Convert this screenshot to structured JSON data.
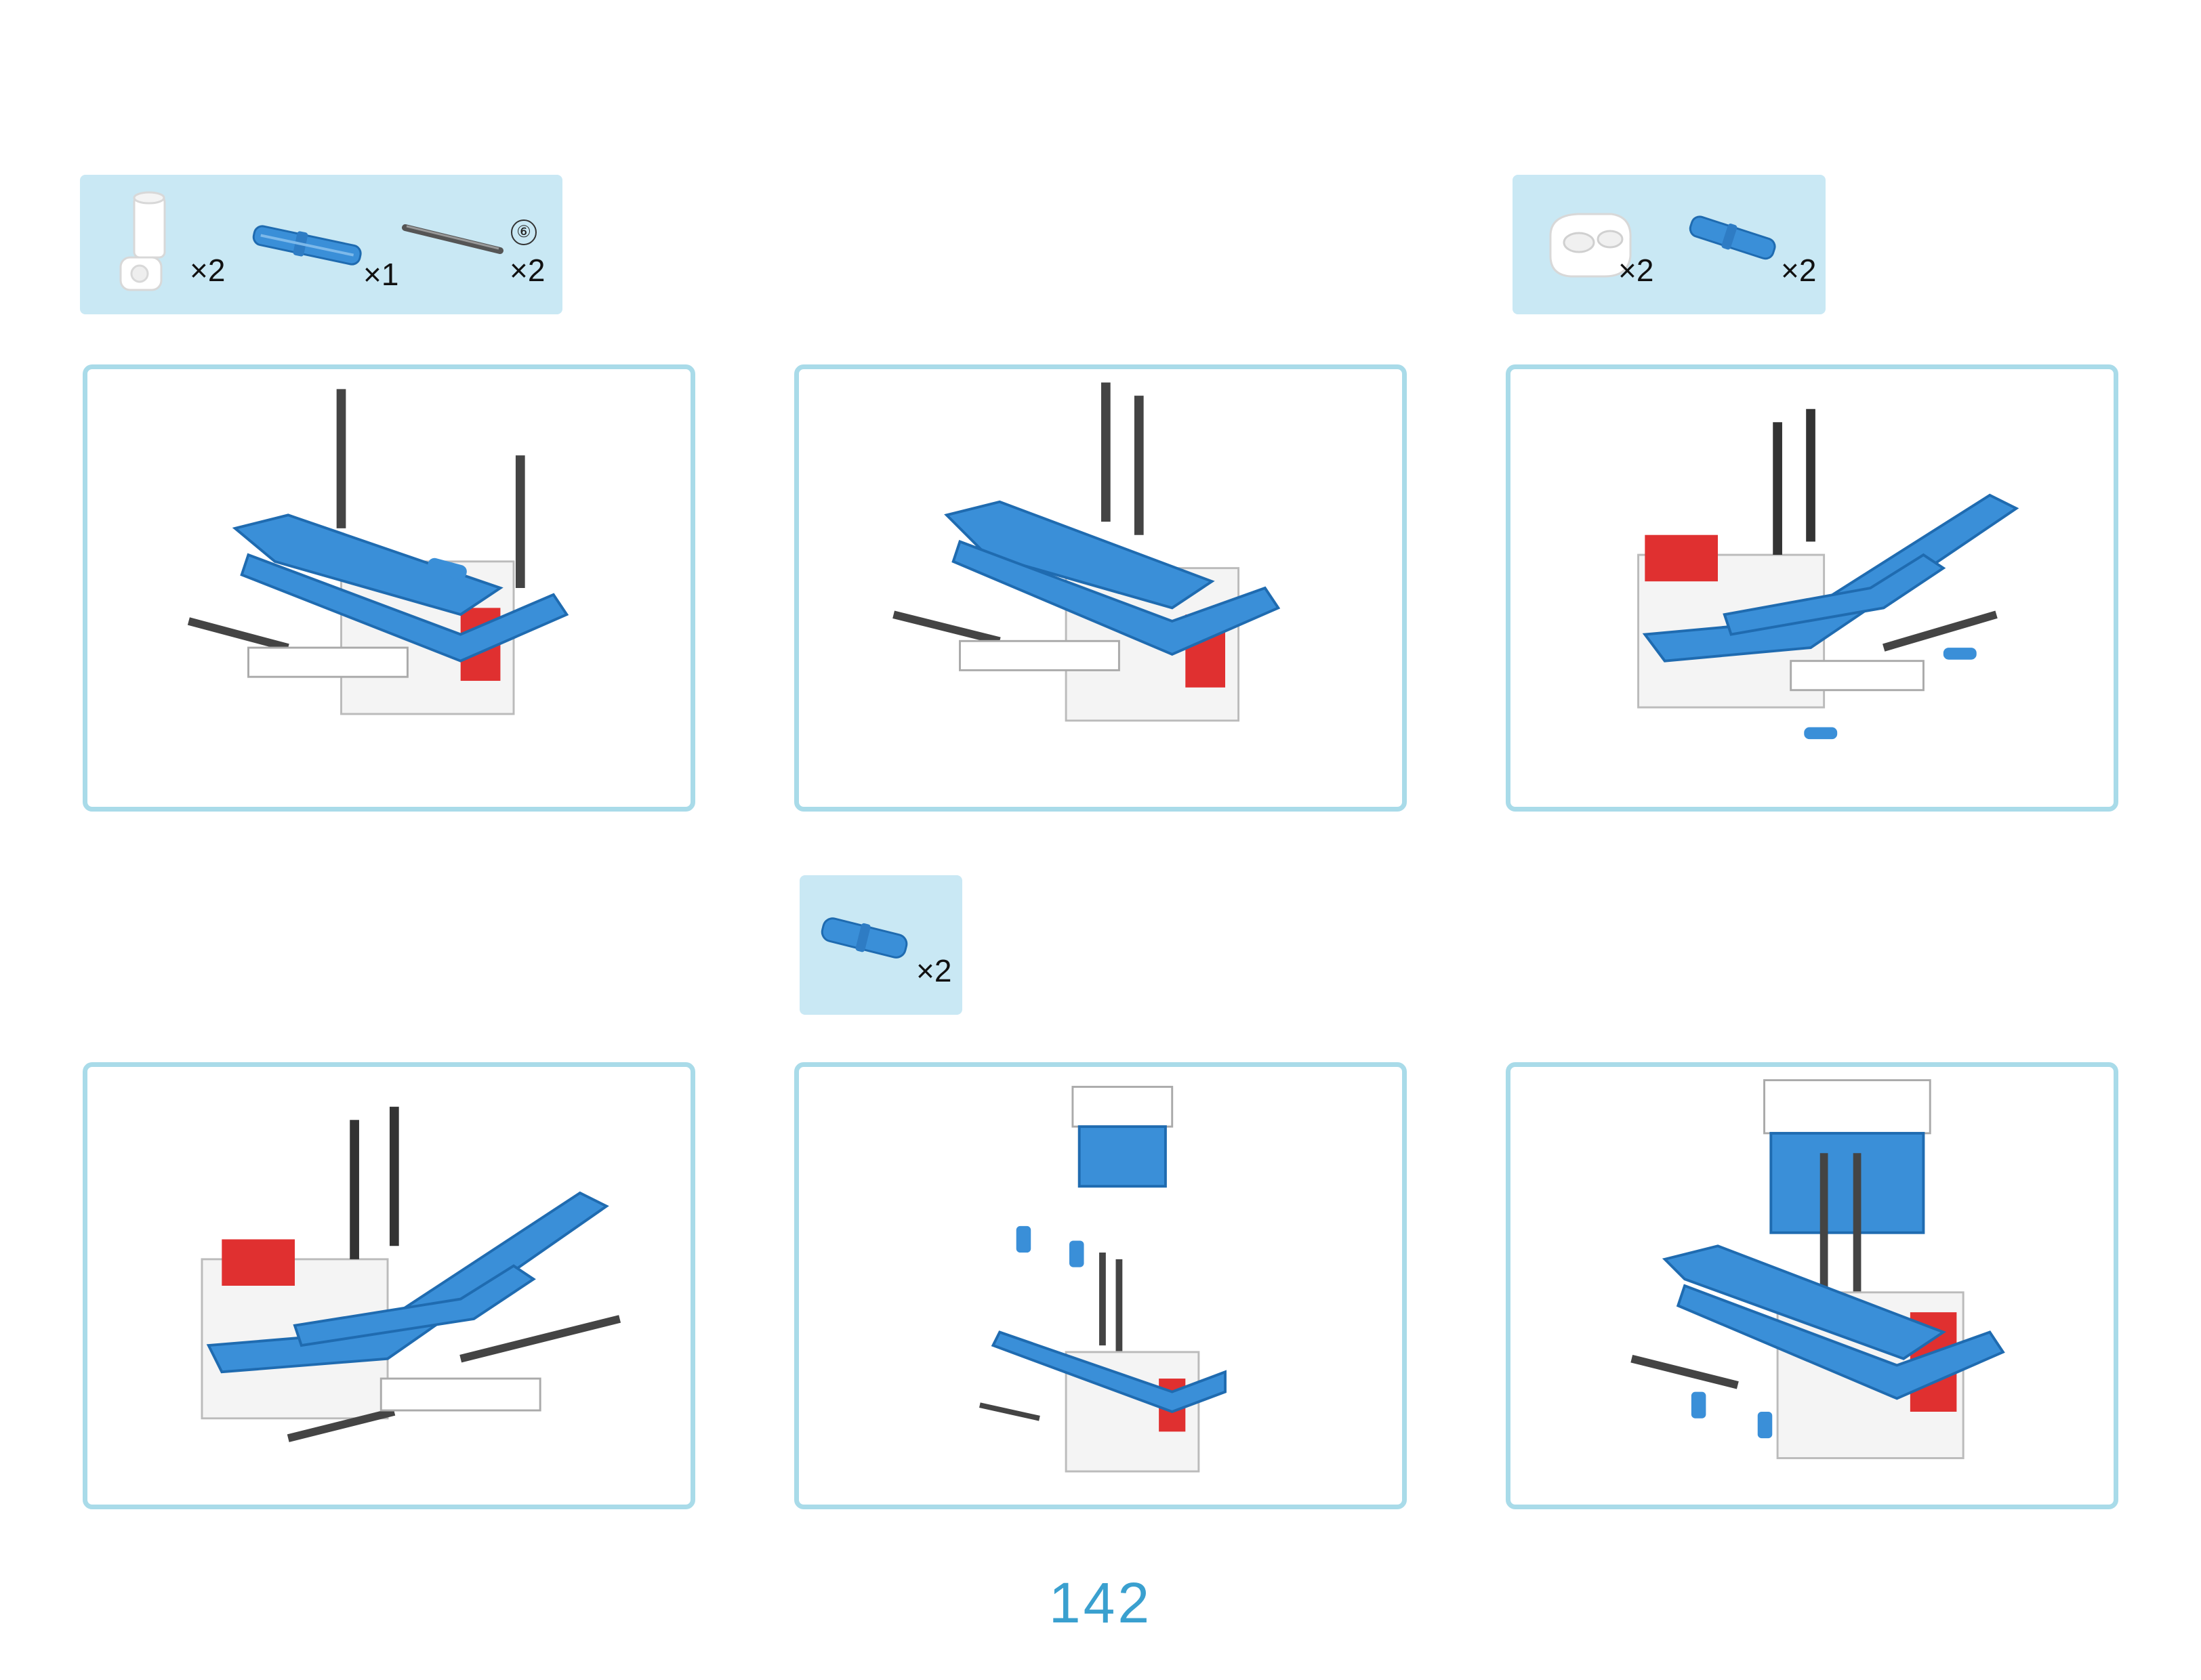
{
  "parts_box_1": {
    "items": [
      {
        "icon": "white-axle-connector-icon",
        "qty": "×2"
      },
      {
        "icon": "blue-long-pin-icon",
        "qty": "×1"
      },
      {
        "icon": "grey-axle-icon",
        "size_badge": "⑥",
        "qty": "×2"
      }
    ]
  },
  "parts_box_2": {
    "items": [
      {
        "icon": "white-double-bush-icon",
        "qty": "×2"
      },
      {
        "icon": "blue-axle-pin-icon",
        "qty": "×2"
      }
    ]
  },
  "parts_box_3": {
    "items": [
      {
        "icon": "blue-pin-icon",
        "qty": "×2"
      }
    ]
  },
  "steps": [
    {
      "step": "step-1"
    },
    {
      "step": "step-2"
    },
    {
      "step": "step-3"
    },
    {
      "step": "step-4"
    },
    {
      "step": "step-5"
    },
    {
      "step": "step-6"
    }
  ],
  "colors": {
    "beam_blue": "#3a8fd8",
    "part_box_bg": "#c9e8f4",
    "panel_border": "#a9dbe9",
    "accent_red": "#e03030",
    "axle_dark": "#333333",
    "page_number": "#3aa0cf"
  },
  "page": {
    "number": "142"
  }
}
